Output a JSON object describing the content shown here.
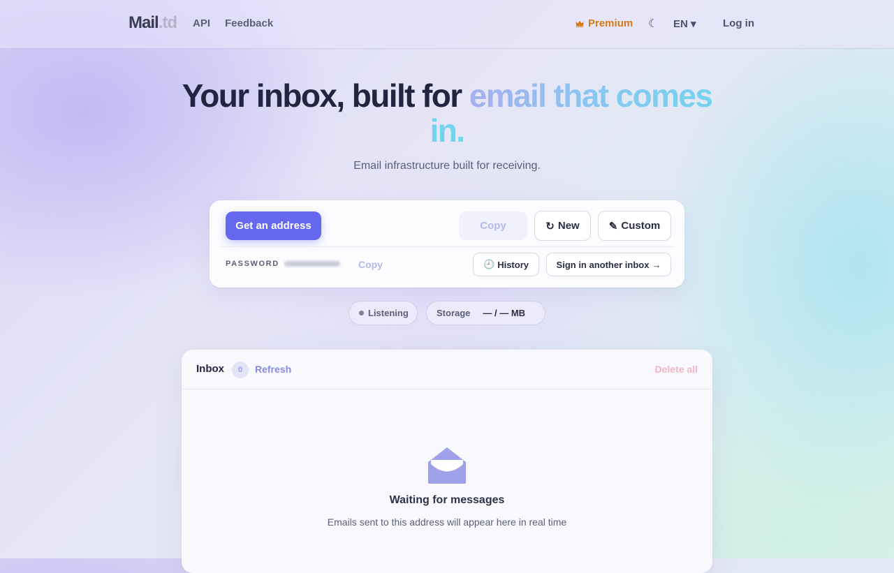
{
  "header": {
    "logo_main": "Mail",
    "logo_suffix": ".td",
    "nav": {
      "api": "API",
      "feedback": "Feedback"
    },
    "premium_label": "Premium",
    "premium_icon": "crown-icon",
    "theme_icon": "moon-icon",
    "theme_glyph": "☾",
    "language": "EN ▾",
    "login": "Log in"
  },
  "hero": {
    "title_plain": "Your inbox, built for ",
    "title_highlight": "email that comes in.",
    "subtitle": "Email infrastructure built for receiving."
  },
  "address_card": {
    "get_address": "Get an address",
    "copy": "Copy",
    "new_icon": "↻",
    "new_label": "New",
    "custom_icon": "✎",
    "custom_label": "Custom",
    "password_label": "PASSWORD",
    "password_copy": "Copy",
    "history_icon": "🕘",
    "history_label": "History",
    "sign_in_other": "Sign in another inbox",
    "sign_in_arrow": "→"
  },
  "status": {
    "listening": "Listening",
    "storage_label": "Storage",
    "storage_value": "— / — MB"
  },
  "inbox": {
    "title": "Inbox",
    "count": "0",
    "refresh": "Refresh",
    "delete_all": "Delete all",
    "empty_icon": "open-envelope-icon",
    "empty_title": "Waiting for messages",
    "empty_subtitle": "Emails sent to this address will appear here in real time"
  },
  "colors": {
    "primary": "#6567ee",
    "premium": "#d77a14",
    "danger_soft": "#f2b4c6",
    "accent_gradient_start": "#a6afef",
    "accent_gradient_end": "#6fd6ee"
  }
}
